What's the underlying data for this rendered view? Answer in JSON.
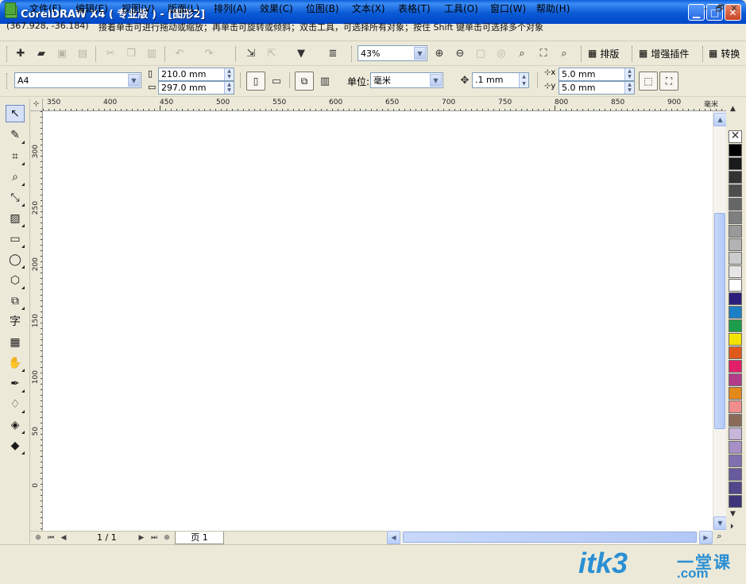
{
  "window": {
    "title": "CorelDRAW X4 ( 专业版 ) - [图形2]",
    "minimize_glyph": "▁",
    "maximize_glyph": "□",
    "close_glyph": "✕"
  },
  "menu": {
    "items": [
      "文件(F)",
      "编辑(E)",
      "视图(V)",
      "版面(L)",
      "排列(A)",
      "效果(C)",
      "位图(B)",
      "文本(X)",
      "表格(T)",
      "工具(O)",
      "窗口(W)",
      "帮助(H)"
    ],
    "mdi": [
      "–",
      "🗗",
      "✕"
    ]
  },
  "standard_toolbar": {
    "zoom_value": "43%",
    "buttons": [
      "排版",
      "增强插件",
      "转换"
    ]
  },
  "property_bar": {
    "paper_size": "A4",
    "width": "210.0 mm",
    "height": "297.0 mm",
    "unit_label": "单位:",
    "unit_value": "毫米",
    "nudge_value": ".1 mm",
    "dup_x": "5.0 mm",
    "dup_y": "5.0 mm"
  },
  "ruler": {
    "unit": "毫米",
    "h_labels": [
      "350",
      "400",
      "450",
      "500",
      "550",
      "600",
      "650",
      "700",
      "750",
      "800",
      "850",
      "900"
    ],
    "v_labels": [
      "300",
      "250",
      "200",
      "150",
      "100",
      "50",
      "0"
    ]
  },
  "page_nav": {
    "page_count": "1 / 1",
    "page_tab": "页 1"
  },
  "palette": {
    "colors": [
      "#000000",
      "#1a1a1a",
      "#333333",
      "#4d4d4d",
      "#666666",
      "#7f7f7f",
      "#999999",
      "#b3b3b3",
      "#cccccc",
      "#e5e5e5",
      "#ffffff",
      "#2a1f7a",
      "#1d7fc4",
      "#1e9e4a",
      "#f3e400",
      "#e05a1c",
      "#e21f68",
      "#b23c8a",
      "#e3891c",
      "#f08d8d",
      "#8a6b5a",
      "#c7b5da",
      "#a690c6",
      "#8070b0",
      "#675b9e",
      "#52468a",
      "#3e3478"
    ]
  },
  "status": {
    "coords": "(367.928, -36.184)",
    "hint": "接着单击可进行拖动或缩放；再单击可旋转或倾斜；双击工具，可选择所有对象；按住 Shift 键单击可选择多个对象"
  },
  "watermark": {
    "logo": "itk3",
    "cn": "一堂课",
    "domain": ".com"
  }
}
